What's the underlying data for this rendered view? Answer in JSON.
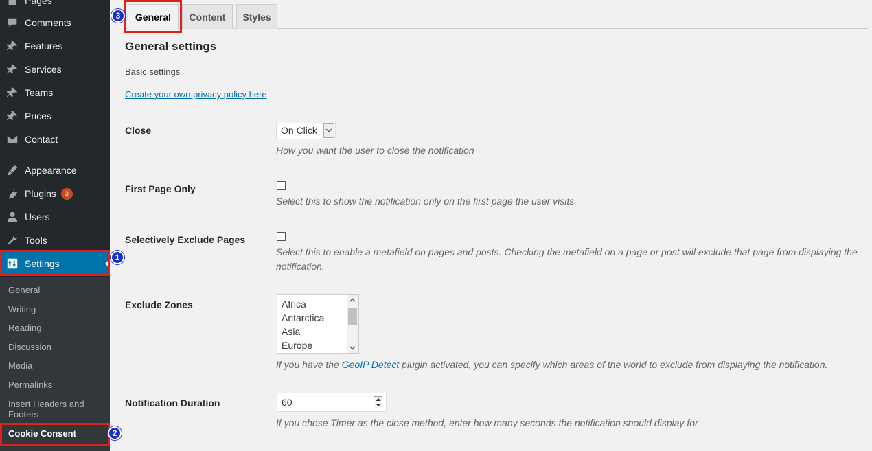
{
  "sidebar": {
    "items": [
      {
        "label": "Pages",
        "icon": "pages-icon"
      },
      {
        "label": "Comments",
        "icon": "comments-icon"
      },
      {
        "label": "Features",
        "icon": "pin-icon"
      },
      {
        "label": "Services",
        "icon": "pin-icon"
      },
      {
        "label": "Teams",
        "icon": "pin-icon"
      },
      {
        "label": "Prices",
        "icon": "pin-icon"
      },
      {
        "label": "Contact",
        "icon": "envelope-icon"
      },
      {
        "label": "Appearance",
        "icon": "brush-icon"
      },
      {
        "label": "Plugins",
        "icon": "plug-icon",
        "badge": "3"
      },
      {
        "label": "Users",
        "icon": "user-icon"
      },
      {
        "label": "Tools",
        "icon": "wrench-icon"
      },
      {
        "label": "Settings",
        "icon": "settings-icon"
      }
    ],
    "submenu": [
      "General",
      "Writing",
      "Reading",
      "Discussion",
      "Media",
      "Permalinks",
      "Insert Headers and Footers",
      "Cookie Consent"
    ]
  },
  "annotations": {
    "step1": "1",
    "step2": "2",
    "step3": "3"
  },
  "tabs": [
    "General",
    "Content",
    "Styles"
  ],
  "main": {
    "heading": "General settings",
    "basic": "Basic settings",
    "policy_link": "Create your own privacy policy here",
    "close": {
      "label": "Close",
      "value": "On Click",
      "desc": "How you want the user to close the notification"
    },
    "first_page": {
      "label": "First Page Only",
      "desc": "Select this to show the notification only on the first page the user visits"
    },
    "exclude_pages": {
      "label": "Selectively Exclude Pages",
      "desc": "Select this to enable a metafield on pages and posts. Checking the metafield on a page or post will exclude that page from displaying the notification."
    },
    "exclude_zones": {
      "label": "Exclude Zones",
      "options": [
        "Africa",
        "Antarctica",
        "Asia",
        "Europe"
      ],
      "desc_before": "If you have the ",
      "desc_link": "GeoIP Detect",
      "desc_after": " plugin activated, you can specify which areas of the world to exclude from displaying the notification."
    },
    "duration": {
      "label": "Notification Duration",
      "value": "60",
      "desc": "If you chose Timer as the close method, enter how many seconds the notification should display for"
    }
  },
  "colors": {
    "sidebar": "#23282d",
    "submenu": "#32373c",
    "active": "#0073aa",
    "highlight": "#e0201b",
    "step": "#1b30c9"
  }
}
